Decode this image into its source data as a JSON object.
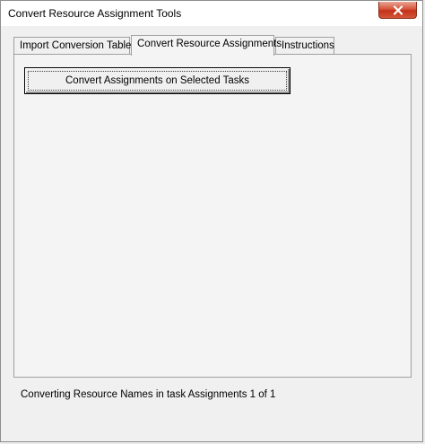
{
  "window": {
    "title": "Convert Resource Assignment Tools"
  },
  "tabs": [
    {
      "label": "Import Conversion Table",
      "active": false
    },
    {
      "label": "Convert Resource Assignments",
      "active": true
    },
    {
      "label": "Instructions",
      "active": false
    }
  ],
  "panel": {
    "convert_button_label": "Convert Assignments on Selected Tasks"
  },
  "status": {
    "text": "Converting Resource Names in task Assignments 1 of 1"
  },
  "icons": {
    "close": "close-icon"
  },
  "colors": {
    "close_button": "#c9402a",
    "window_background": "#f0f0f0"
  }
}
